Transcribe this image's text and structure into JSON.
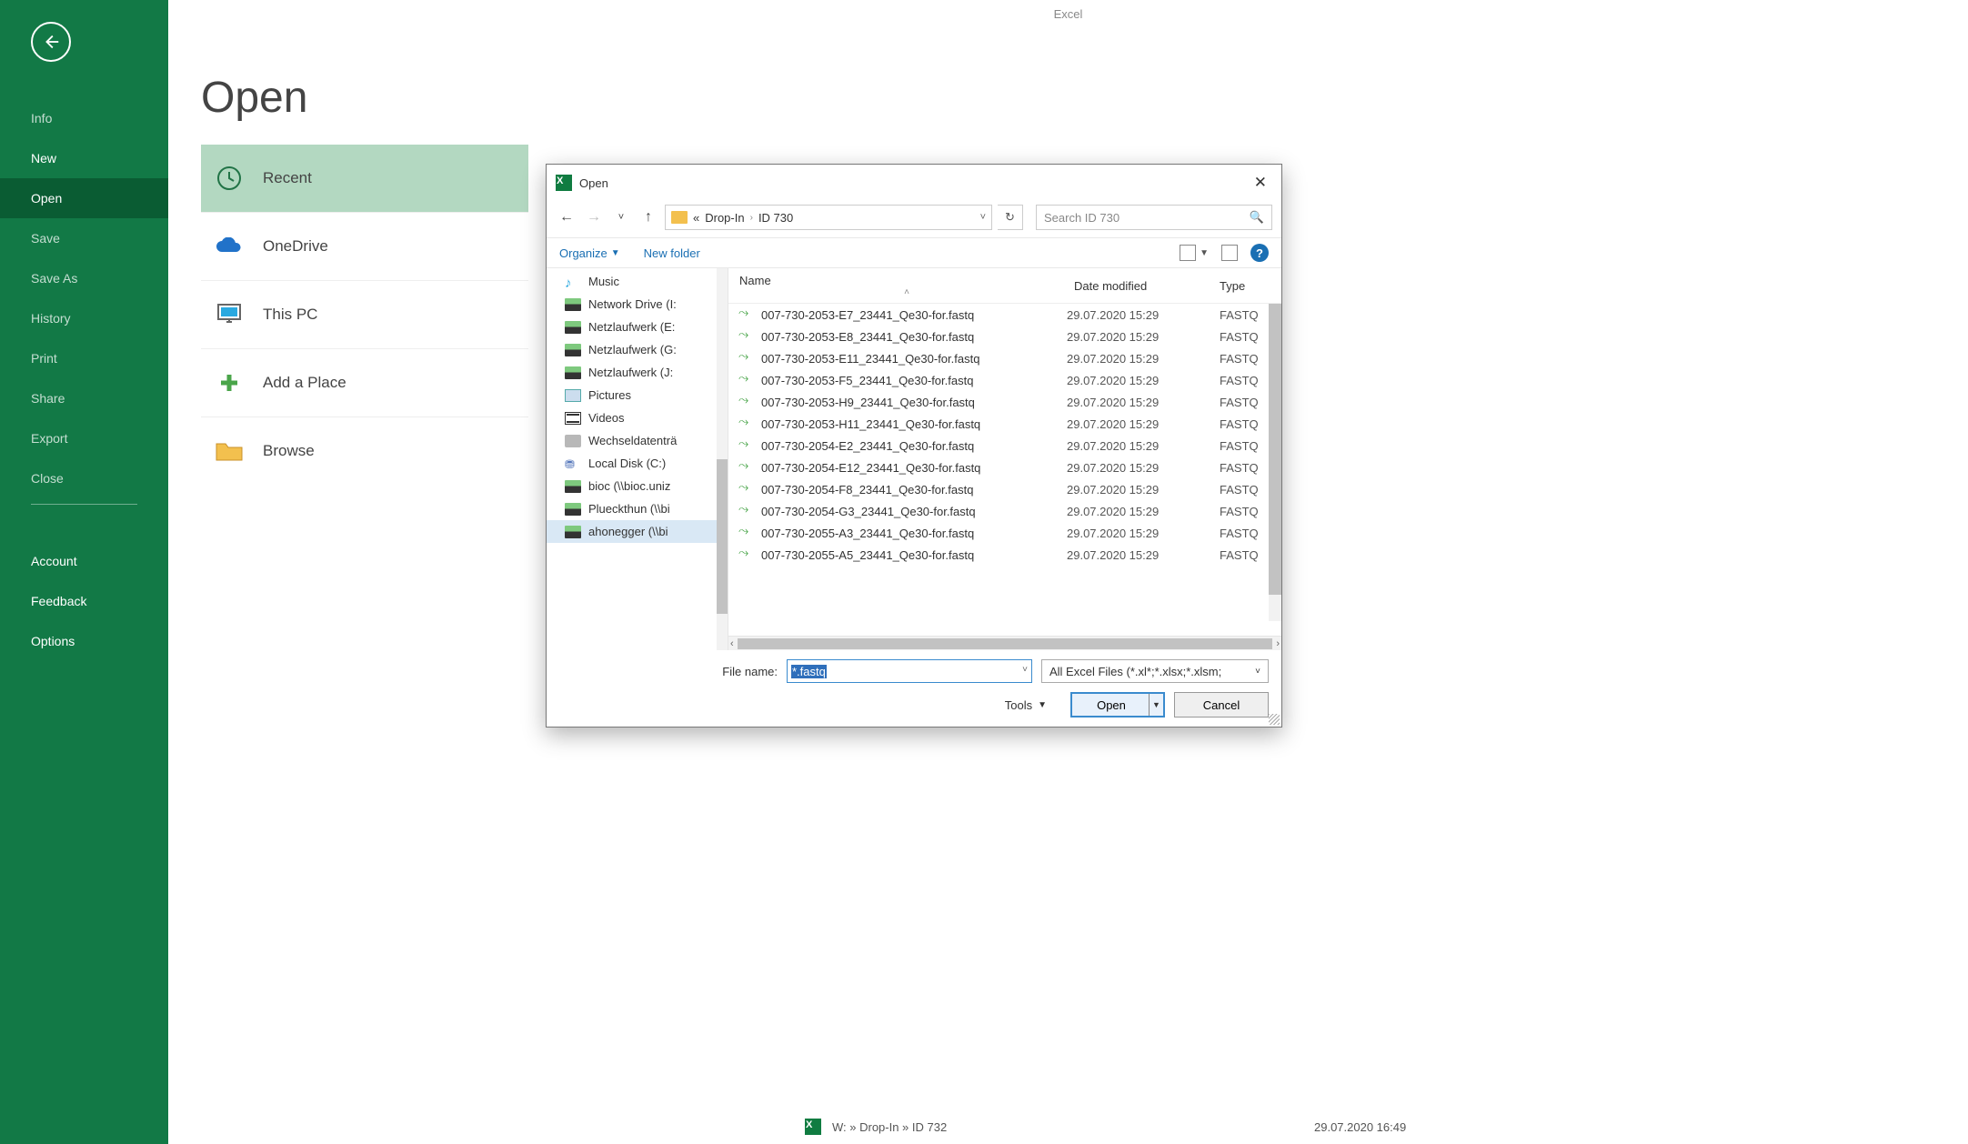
{
  "app_title": "Excel",
  "sidebar": {
    "items": [
      {
        "label": "Info",
        "bright": false
      },
      {
        "label": "New",
        "bright": true
      },
      {
        "label": "Open",
        "bright": true,
        "active": true
      },
      {
        "label": "Save",
        "bright": false
      },
      {
        "label": "Save As",
        "bright": false
      },
      {
        "label": "History",
        "bright": false
      },
      {
        "label": "Print",
        "bright": false
      },
      {
        "label": "Share",
        "bright": false
      },
      {
        "label": "Export",
        "bright": false
      },
      {
        "label": "Close",
        "bright": false
      }
    ],
    "footer": [
      {
        "label": "Account"
      },
      {
        "label": "Feedback"
      },
      {
        "label": "Options"
      }
    ]
  },
  "main": {
    "heading": "Open",
    "locations": [
      {
        "label": "Recent",
        "icon": "clock"
      },
      {
        "label": "OneDrive",
        "icon": "cloud"
      },
      {
        "label": "This PC",
        "icon": "monitor"
      },
      {
        "label": "Add a Place",
        "icon": "plus"
      },
      {
        "label": "Browse",
        "icon": "folder"
      }
    ]
  },
  "recent_row": {
    "path": "W: » Drop-In » ID 732",
    "date": "29.07.2020 16:49"
  },
  "dialog": {
    "title": "Open",
    "crumbs_prefix": "«",
    "crumbs": [
      "Drop-In",
      "ID 730"
    ],
    "search_placeholder": "Search ID 730",
    "organize_label": "Organize",
    "newfolder_label": "New folder",
    "tree": [
      {
        "label": "Music",
        "icon": "music"
      },
      {
        "label": "Network Drive (I:",
        "icon": "drive"
      },
      {
        "label": "Netzlaufwerk (E:",
        "icon": "drive"
      },
      {
        "label": "Netzlaufwerk (G:",
        "icon": "drive"
      },
      {
        "label": "Netzlaufwerk (J:",
        "icon": "drive"
      },
      {
        "label": "Pictures",
        "icon": "pic"
      },
      {
        "label": "Videos",
        "icon": "vid"
      },
      {
        "label": "Wechseldatenträ",
        "icon": "ext"
      },
      {
        "label": "Local Disk (C:)",
        "icon": "local"
      },
      {
        "label": "bioc (\\\\bioc.uniz",
        "icon": "drive"
      },
      {
        "label": "Plueckthun (\\\\bi",
        "icon": "drive"
      },
      {
        "label": "ahonegger (\\\\bi",
        "icon": "drive",
        "active": true
      }
    ],
    "columns": {
      "name": "Name",
      "date": "Date modified",
      "type": "Type"
    },
    "files": [
      {
        "name": "007-730-2053-E7_23441_Qe30-for.fastq",
        "date": "29.07.2020 15:29",
        "type": "FASTQ"
      },
      {
        "name": "007-730-2053-E8_23441_Qe30-for.fastq",
        "date": "29.07.2020 15:29",
        "type": "FASTQ"
      },
      {
        "name": "007-730-2053-E11_23441_Qe30-for.fastq",
        "date": "29.07.2020 15:29",
        "type": "FASTQ"
      },
      {
        "name": "007-730-2053-F5_23441_Qe30-for.fastq",
        "date": "29.07.2020 15:29",
        "type": "FASTQ"
      },
      {
        "name": "007-730-2053-H9_23441_Qe30-for.fastq",
        "date": "29.07.2020 15:29",
        "type": "FASTQ"
      },
      {
        "name": "007-730-2053-H11_23441_Qe30-for.fastq",
        "date": "29.07.2020 15:29",
        "type": "FASTQ"
      },
      {
        "name": "007-730-2054-E2_23441_Qe30-for.fastq",
        "date": "29.07.2020 15:29",
        "type": "FASTQ"
      },
      {
        "name": "007-730-2054-E12_23441_Qe30-for.fastq",
        "date": "29.07.2020 15:29",
        "type": "FASTQ"
      },
      {
        "name": "007-730-2054-F8_23441_Qe30-for.fastq",
        "date": "29.07.2020 15:29",
        "type": "FASTQ"
      },
      {
        "name": "007-730-2054-G3_23441_Qe30-for.fastq",
        "date": "29.07.2020 15:29",
        "type": "FASTQ"
      },
      {
        "name": "007-730-2055-A3_23441_Qe30-for.fastq",
        "date": "29.07.2020 15:29",
        "type": "FASTQ"
      },
      {
        "name": "007-730-2055-A5_23441_Qe30-for.fastq",
        "date": "29.07.2020 15:29",
        "type": "FASTQ"
      }
    ],
    "filename_label": "File name:",
    "filename_value": "*.fastq",
    "filter_label": "All Excel Files (*.xl*;*.xlsx;*.xlsm;",
    "tools_label": "Tools",
    "open_label": "Open",
    "cancel_label": "Cancel"
  }
}
